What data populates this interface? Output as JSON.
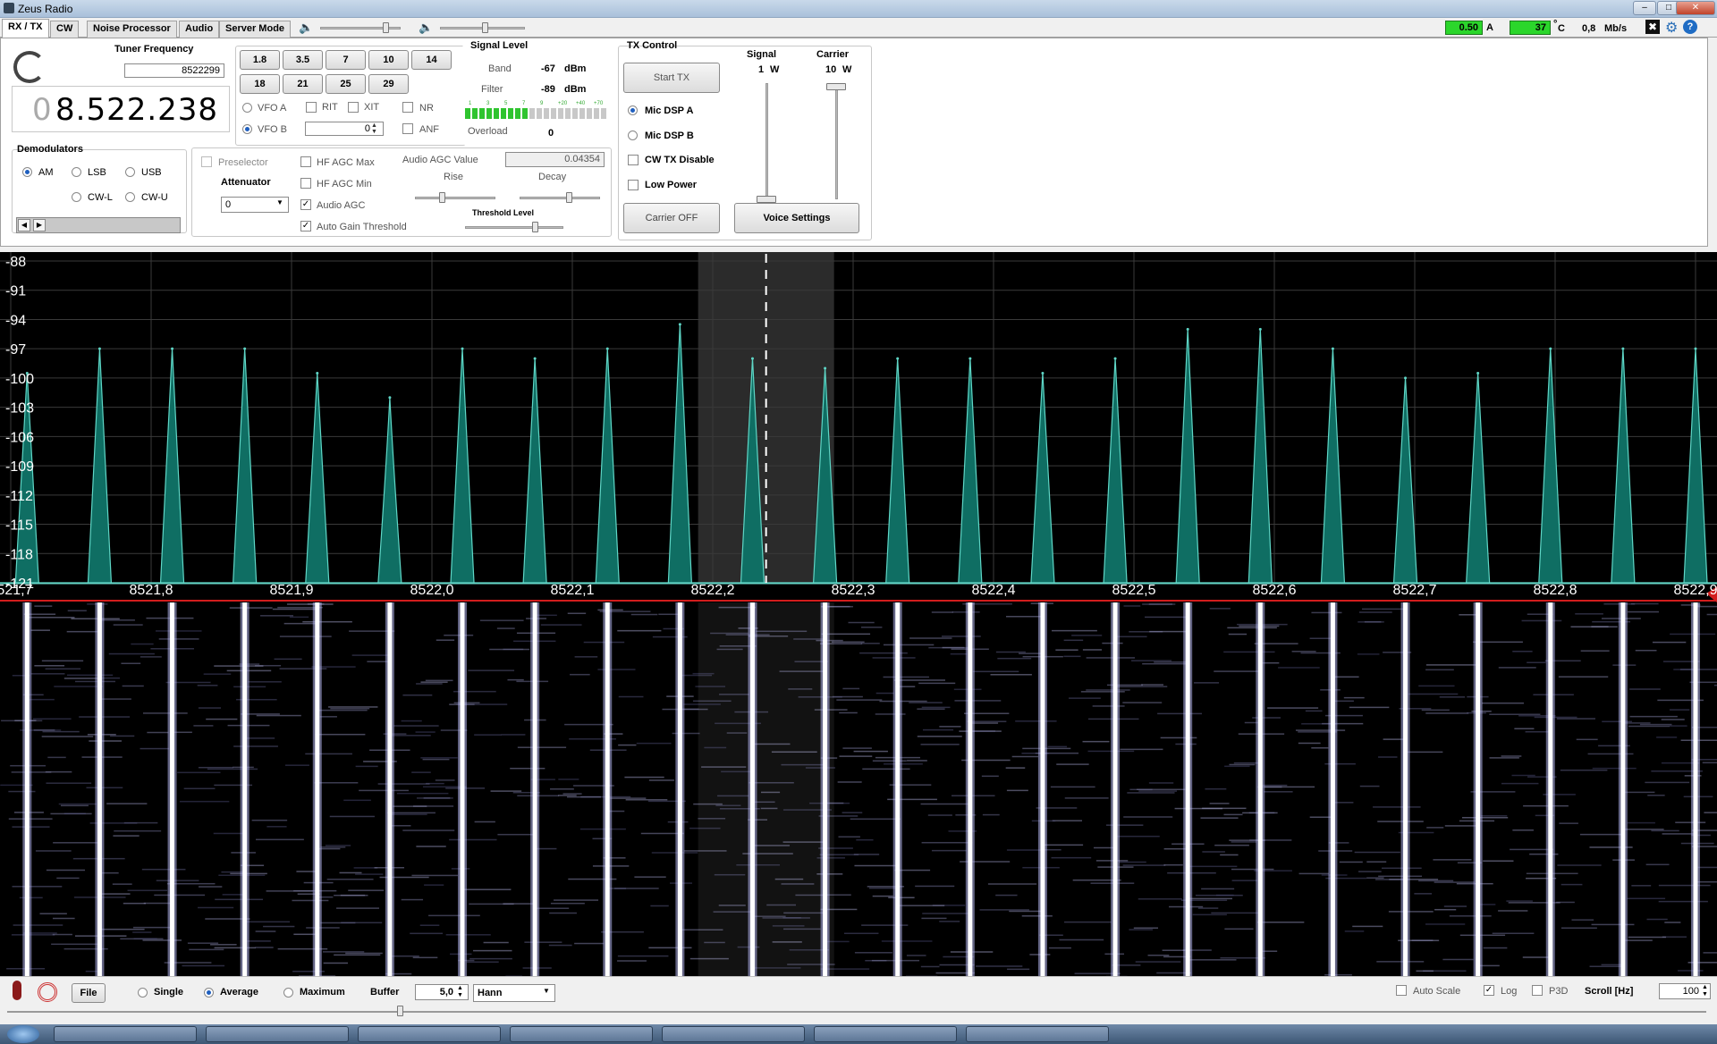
{
  "window": {
    "title": "Zeus Radio"
  },
  "tabs": [
    "RX / TX",
    "CW",
    "Noise Processor",
    "Audio",
    "Server Mode"
  ],
  "status": {
    "current_value": "0.50",
    "current_unit": "A",
    "temp_value": "37",
    "temp_unit": "C",
    "temp_deg": "°",
    "rate": "0,8",
    "rate_unit": "Mb/s"
  },
  "tuner": {
    "label": "Tuner Frequency",
    "input_value": "8522299",
    "display_prefix": "0",
    "display_digits": "8.522.238",
    "bands_row1": [
      "1.8",
      "3.5",
      "7",
      "10",
      "14"
    ],
    "bands_row2": [
      "18",
      "21",
      "25",
      "29"
    ],
    "vfo_a": "VFO A",
    "vfo_b": "VFO B",
    "rit": "RIT",
    "xit": "XIT",
    "nr": "NR",
    "anf": "ANF",
    "offset_value": "0"
  },
  "signal_level": {
    "title": "Signal Level",
    "band_label": "Band",
    "band_value": "-67",
    "band_unit": "dBm",
    "filter_label": "Filter",
    "filter_value": "-89",
    "filter_unit": "dBm",
    "overload_label": "Overload",
    "overload_value": "0",
    "meter_labels": [
      "1",
      "3",
      "5",
      "7",
      "9",
      "+20",
      "+40",
      "+70"
    ],
    "meter_level": 0.45
  },
  "tx_control": {
    "title": "TX Control",
    "start_tx": "Start TX",
    "mic_dsp_a": "Mic DSP A",
    "mic_dsp_b": "Mic DSP B",
    "cw_tx_disable": "CW TX Disable",
    "low_power": "Low Power",
    "carrier_off": "Carrier OFF",
    "voice_settings": "Voice Settings",
    "signal_label": "Signal",
    "signal_value": "1",
    "signal_unit": "W",
    "carrier_label": "Carrier",
    "carrier_value": "10",
    "carrier_unit": "W",
    "signal_level": 0.0,
    "carrier_level": 1.0
  },
  "demodulators": {
    "title": "Demodulators",
    "modes": [
      "AM",
      "LSB",
      "USB",
      "CW-L",
      "CW-U"
    ],
    "selected": "AM"
  },
  "agc": {
    "preselector": "Preselector",
    "attenuator": "Attenuator",
    "attenuator_value": "0",
    "hf_agc_max": "HF AGC Max",
    "hf_agc_min": "HF AGC Min",
    "audio_agc": "Audio AGC",
    "auto_gain_threshold": "Auto Gain Threshold",
    "audio_agc_value_label": "Audio AGC Value",
    "audio_agc_value": "0.04354",
    "rise": "Rise",
    "decay": "Decay",
    "threshold_level": "Threshold Level"
  },
  "spectrum": {
    "y_labels": [
      "-88",
      "-91",
      "-94",
      "-97",
      "-100",
      "-103",
      "-106",
      "-109",
      "-112",
      "-115",
      "-118",
      "-121"
    ],
    "x_labels": [
      "8521,7",
      "8521,8",
      "8521,9",
      "8522,0",
      "8522,1",
      "8522,2",
      "8522,3",
      "8522,4",
      "8522,5",
      "8522,6",
      "8522,7",
      "8522,8",
      "8522,9"
    ],
    "peak_color": "#5fd6c6",
    "peaks_dbm": [
      -100,
      -99.5,
      -97,
      -97,
      -97,
      -99.5,
      -102,
      -97,
      -98,
      -97,
      -94.5,
      -98,
      -99,
      -98,
      -98,
      -99.5,
      -98,
      -95,
      -95,
      -97,
      -100,
      -99.5,
      -97,
      -97,
      -97
    ]
  },
  "bottom": {
    "file": "File",
    "single": "Single",
    "average": "Average",
    "maximum": "Maximum",
    "buffer_label": "Buffer",
    "buffer_value": "5,0",
    "window_value": "Hann",
    "auto_scale": "Auto Scale",
    "log": "Log",
    "p3d": "P3D",
    "scroll_label": "Scroll [Hz]",
    "scroll_value": "100"
  }
}
